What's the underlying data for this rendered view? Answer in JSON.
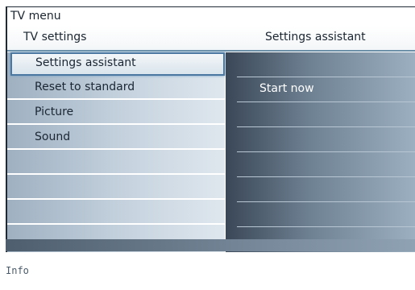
{
  "menu_title": "TV menu",
  "header": {
    "left": "TV settings",
    "right": "Settings assistant"
  },
  "left_menu": {
    "items": [
      {
        "label": "Settings assistant",
        "selected": true
      },
      {
        "label": "Reset to standard",
        "selected": false
      },
      {
        "label": "Picture",
        "selected": false
      },
      {
        "label": "Sound",
        "selected": false
      },
      {
        "label": "",
        "selected": false
      },
      {
        "label": "",
        "selected": false
      },
      {
        "label": "",
        "selected": false
      },
      {
        "label": "",
        "selected": false
      }
    ]
  },
  "right_menu": {
    "items": [
      {
        "label": ""
      },
      {
        "label": "Start now"
      },
      {
        "label": ""
      },
      {
        "label": ""
      },
      {
        "label": ""
      },
      {
        "label": ""
      },
      {
        "label": ""
      }
    ]
  },
  "info_label": "Info",
  "colors": {
    "selection_border": "#4a78a0",
    "right_panel_dark": "#3a4757",
    "left_panel_light": "#dfe7ee"
  }
}
